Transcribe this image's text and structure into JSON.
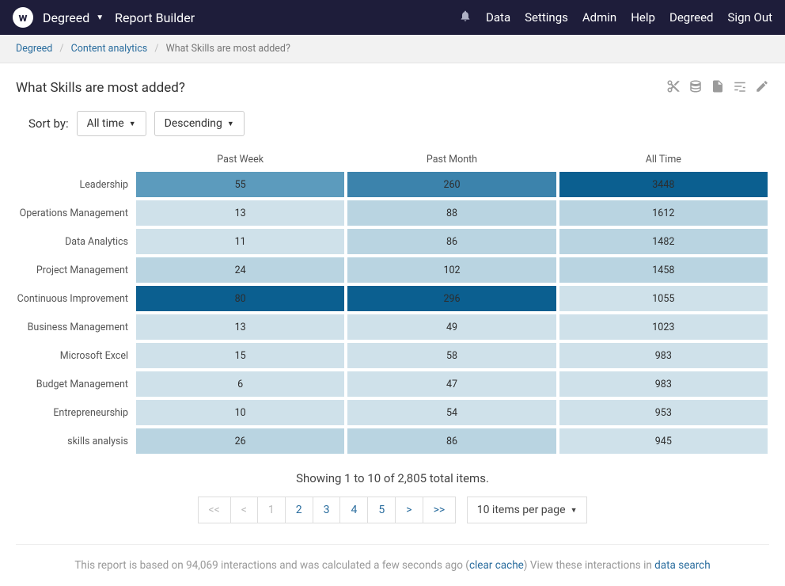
{
  "nav": {
    "logo_letter": "w",
    "brand": "Degreed",
    "app_title": "Report Builder",
    "links": {
      "data": "Data",
      "settings": "Settings",
      "admin": "Admin",
      "help": "Help",
      "degreed": "Degreed",
      "signout": "Sign Out"
    }
  },
  "breadcrumb": {
    "a": "Degreed",
    "b": "Content analytics",
    "c": "What Skills are most added?"
  },
  "title": "What Skills are most added?",
  "sort": {
    "label": "Sort by:",
    "range": "All time",
    "direction": "Descending"
  },
  "columns": [
    "Past Week",
    "Past Month",
    "All Time"
  ],
  "rows": [
    {
      "label": "Leadership",
      "vals": [
        55,
        260,
        3448
      ]
    },
    {
      "label": "Operations Management",
      "vals": [
        13,
        88,
        1612
      ]
    },
    {
      "label": "Data Analytics",
      "vals": [
        11,
        86,
        1482
      ]
    },
    {
      "label": "Project Management",
      "vals": [
        24,
        102,
        1458
      ]
    },
    {
      "label": "Continuous Improvement",
      "vals": [
        80,
        296,
        1055
      ]
    },
    {
      "label": "Business Management",
      "vals": [
        13,
        49,
        1023
      ]
    },
    {
      "label": "Microsoft Excel",
      "vals": [
        15,
        58,
        983
      ]
    },
    {
      "label": "Budget Management",
      "vals": [
        6,
        47,
        983
      ]
    },
    {
      "label": "Entrepreneurship",
      "vals": [
        10,
        54,
        953
      ]
    },
    {
      "label": "skills analysis",
      "vals": [
        26,
        86,
        945
      ]
    }
  ],
  "colors": {
    "scale": [
      "#cfe1ea",
      "#b9d4e1",
      "#a0c6d8",
      "#7fb2cb",
      "#5c9bbd",
      "#3c83ac",
      "#1b6a9a",
      "#0b5f90"
    ]
  },
  "showing": "Showing 1 to 10 of 2,805 total items.",
  "pager": {
    "first": "<<",
    "prev": "<",
    "pages": [
      "1",
      "2",
      "3",
      "4",
      "5"
    ],
    "next": ">",
    "last": ">>",
    "current": "1"
  },
  "ipp": "10 items per page",
  "footer": {
    "pre": "This report is based on 94,069 interactions and was calculated a few seconds ago (",
    "clear": "clear cache",
    "mid": ") View these interactions in ",
    "link": "data search"
  },
  "chart_data": {
    "type": "heatmap",
    "title": "What Skills are most added?",
    "columns": [
      "Past Week",
      "Past Month",
      "All Time"
    ],
    "rows": [
      "Leadership",
      "Operations Management",
      "Data Analytics",
      "Project Management",
      "Continuous Improvement",
      "Business Management",
      "Microsoft Excel",
      "Budget Management",
      "Entrepreneurship",
      "skills analysis"
    ],
    "values": [
      [
        55,
        260,
        3448
      ],
      [
        13,
        88,
        1612
      ],
      [
        11,
        86,
        1482
      ],
      [
        24,
        102,
        1458
      ],
      [
        80,
        296,
        1055
      ],
      [
        13,
        49,
        1023
      ],
      [
        15,
        58,
        983
      ],
      [
        6,
        47,
        983
      ],
      [
        10,
        54,
        953
      ],
      [
        26,
        86,
        945
      ]
    ],
    "color_scale": "blue sequential, darker = higher within each column"
  }
}
